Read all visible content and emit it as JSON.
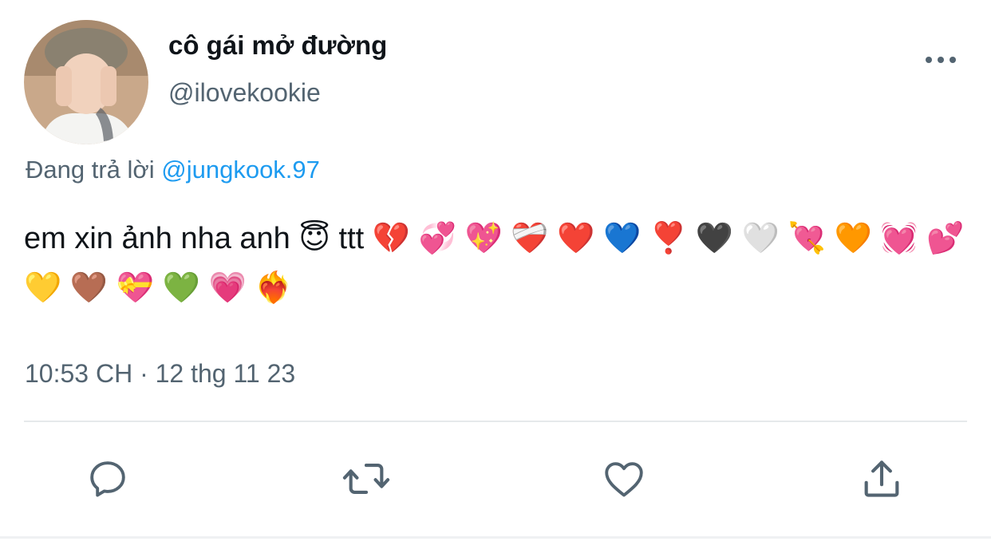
{
  "author": {
    "display_name": "cô gái mở đường",
    "handle": "@ilovekookie"
  },
  "reply_context": {
    "prefix": "Đang trả lời",
    "mention": "@jungkook.97"
  },
  "tweet": {
    "text": "em xin ảnh nha anh 😇 ttt 💔 💞 💖 ❤️‍🩹 ❤️ 💙 ❣️ 🖤 🤍 💘 🧡 💓 💕 💛 🤎 💝 💚 💗 ❤️‍🔥"
  },
  "timestamp": "10:53 CH · 12 thg 11 23",
  "actions": [
    {
      "name": "reply",
      "icon": "reply-icon"
    },
    {
      "name": "retweet",
      "icon": "retweet-icon"
    },
    {
      "name": "like",
      "icon": "heart-icon"
    },
    {
      "name": "share",
      "icon": "share-icon"
    }
  ],
  "colors": {
    "text": "#0f1419",
    "secondary": "#536471",
    "link": "#1d9bf0",
    "divider": "#e6e9eb"
  }
}
